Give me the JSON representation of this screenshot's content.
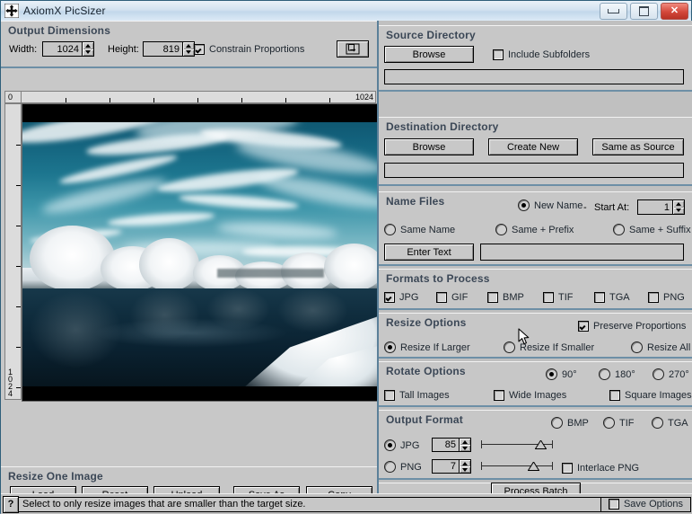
{
  "window": {
    "title": "AxiomX PicSizer",
    "icon": "move-cross-icon",
    "minimize_label": "Minimize",
    "maximize_label": "Maximize",
    "close_label": "✕"
  },
  "output_dimensions": {
    "title": "Output Dimensions",
    "width_label": "Width:",
    "width_value": "1024",
    "height_label": "Height:",
    "height_value": "819",
    "constrain_label": "Constrain Proportions",
    "constrain_checked": true,
    "swap_icon": "swap-dimensions-icon"
  },
  "ruler": {
    "h_start": "0",
    "h_end": "1024",
    "v_start": "0",
    "v_end": "1024"
  },
  "preview": {
    "name": "image-preview",
    "description": "Infrared landscape photograph: white foliage trees along a lake with teal sky and mirror reflections"
  },
  "resize_one_image": {
    "title": "Resize One Image",
    "buttons": [
      "Load",
      "Reset",
      "Unload",
      "Save As",
      "Copy"
    ]
  },
  "source_directory": {
    "title": "Source Directory",
    "browse_label": "Browse",
    "include_subfolders_label": "Include Subfolders",
    "include_subfolders_checked": false,
    "path_value": ""
  },
  "destination_directory": {
    "title": "Destination Directory",
    "browse_label": "Browse",
    "create_new_label": "Create New",
    "same_as_source_label": "Same as Source",
    "path_value": ""
  },
  "name_files": {
    "title": "Name Files",
    "new_name_label": "New Name",
    "dash": "-",
    "start_at_label": "Start At:",
    "start_at_value": "1",
    "same_name_label": "Same Name",
    "same_prefix_label": "Same + Prefix",
    "same_suffix_label": "Same + Suffix",
    "selected": "New Name",
    "enter_text_label": "Enter Text",
    "text_value": ""
  },
  "formats_to_process": {
    "title": "Formats to Process",
    "items": [
      {
        "label": "JPG",
        "checked": true
      },
      {
        "label": "GIF",
        "checked": false
      },
      {
        "label": "BMP",
        "checked": false
      },
      {
        "label": "TIF",
        "checked": false
      },
      {
        "label": "TGA",
        "checked": false
      },
      {
        "label": "PNG",
        "checked": false
      }
    ]
  },
  "resize_options": {
    "title": "Resize Options",
    "preserve_label": "Preserve Proportions",
    "preserve_checked": true,
    "radios": [
      {
        "label": "Resize If Larger",
        "selected": true
      },
      {
        "label": "Resize If Smaller",
        "selected": false
      },
      {
        "label": "Resize All",
        "selected": false
      }
    ]
  },
  "rotate_options": {
    "title": "Rotate Options",
    "angles": [
      {
        "label": "90°",
        "selected": true
      },
      {
        "label": "180°",
        "selected": false
      },
      {
        "label": "270°",
        "selected": false
      }
    ],
    "targets": [
      {
        "label": "Tall Images",
        "checked": false
      },
      {
        "label": "Wide Images",
        "checked": false
      },
      {
        "label": "Square Images",
        "checked": false
      }
    ]
  },
  "output_format": {
    "title": "Output Format",
    "top_radios": [
      {
        "label": "BMP",
        "selected": false
      },
      {
        "label": "TIF",
        "selected": false
      },
      {
        "label": "TGA",
        "selected": false
      }
    ],
    "jpg_label": "JPG",
    "jpg_selected": true,
    "jpg_value": "85",
    "jpg_slider_pct": 82,
    "png_label": "PNG",
    "png_selected": false,
    "png_value": "7",
    "png_slider_pct": 72,
    "interlace_label": "Interlace PNG",
    "interlace_checked": false
  },
  "process": {
    "batch_label": "Process Batch"
  },
  "status_bar": {
    "help_glyph": "?",
    "message": "Select to only resize images that are smaller than the target size.",
    "save_options_label": "Save Options",
    "save_options_checked": false
  },
  "colors": {
    "panel": "#c8c8c8",
    "group_divider": "#6d8fa6",
    "window_border": "#2f5f7a",
    "title_text": "#3b4756",
    "close_button": "#c4392c"
  }
}
